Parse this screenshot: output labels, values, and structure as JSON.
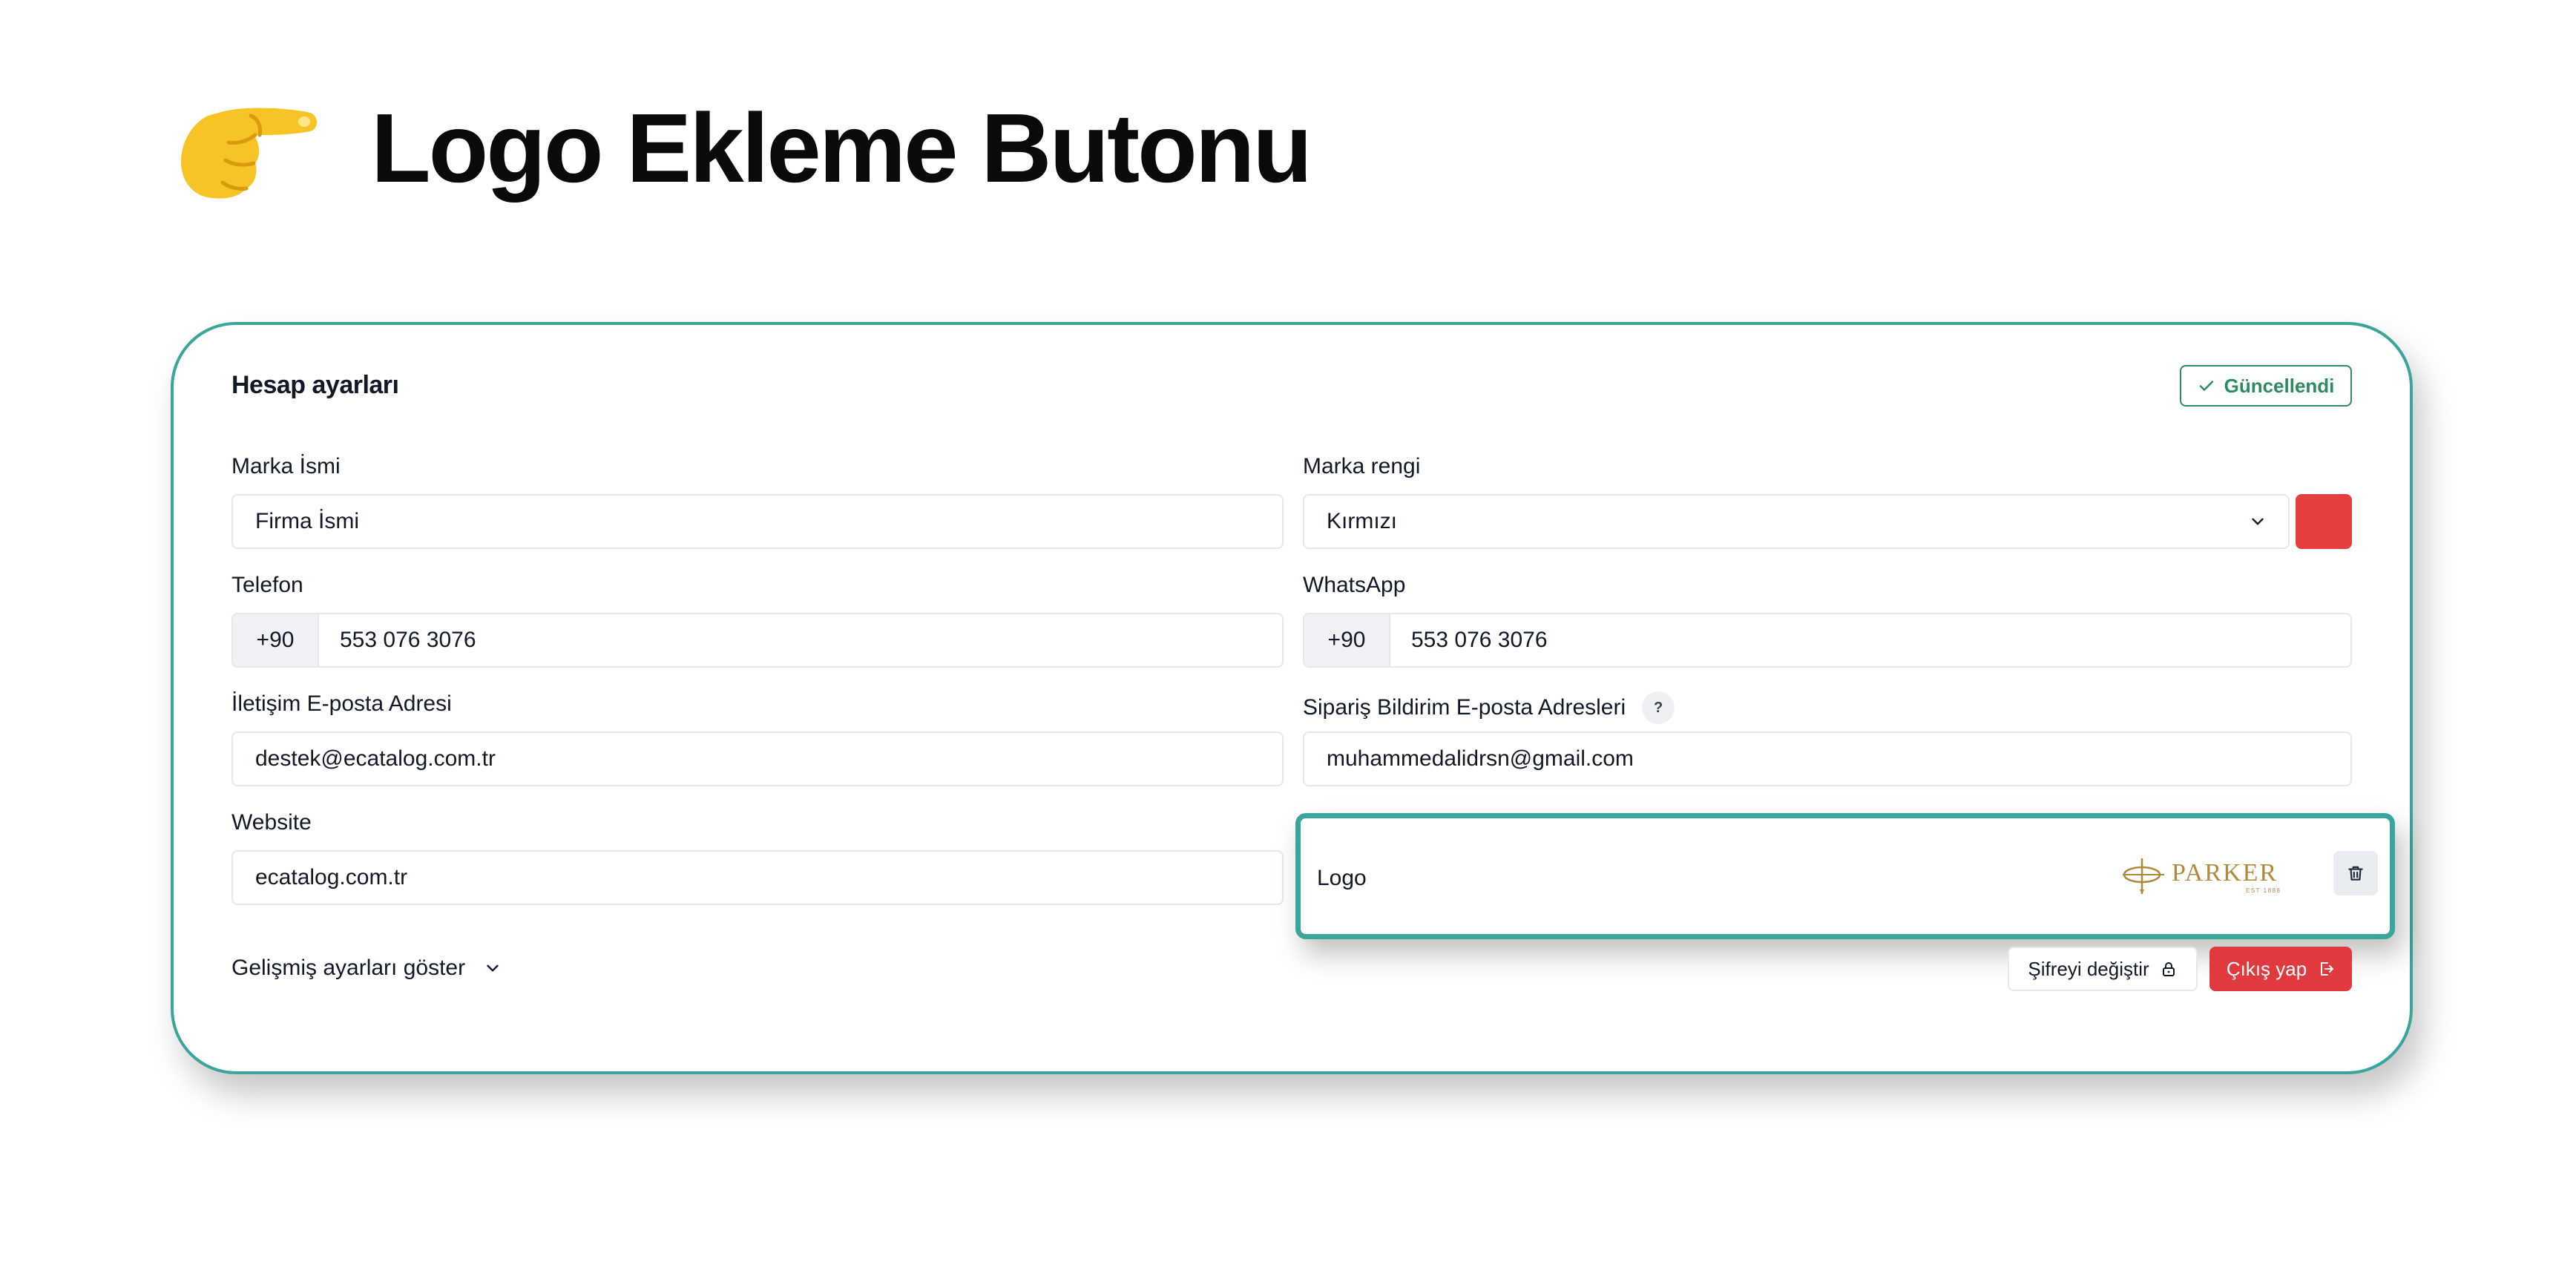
{
  "page_title": "Logo Ekleme Butonu",
  "pointer_icon": "backhand-index-pointing-right-icon",
  "card": {
    "title": "Hesap ayarları",
    "updated_label": "Güncellendi",
    "fields": {
      "brand_name": {
        "label": "Marka İsmi",
        "value": "Firma İsmi"
      },
      "brand_color": {
        "label": "Marka rengi",
        "value": "Kırmızı",
        "swatch_color": "#e53e3e"
      },
      "phone": {
        "label": "Telefon",
        "prefix": "+90",
        "value": "553 076 3076"
      },
      "whatsapp": {
        "label": "WhatsApp",
        "prefix": "+90",
        "value": "553 076 3076"
      },
      "contact_email": {
        "label": "İletişim E-posta Adresi",
        "value": "destek@ecatalog.com.tr"
      },
      "order_email": {
        "label": "Sipariş Bildirim E-posta Adresleri",
        "help": "?",
        "value": "muhammedalidrsn@gmail.com"
      },
      "website": {
        "label": "Website",
        "value": "ecatalog.com.tr"
      },
      "logo": {
        "label": "Logo",
        "brand_text": "PARKER",
        "brand_subtext": "EST 1888"
      }
    },
    "advanced_label": "Gelişmiş ayarları göster",
    "change_password_label": "Şifreyi değiştir",
    "logout_label": "Çıkış yap"
  },
  "colors": {
    "accent_teal": "#3aa59b",
    "success_green": "#2f8a62",
    "danger_red": "#e03a3e"
  }
}
